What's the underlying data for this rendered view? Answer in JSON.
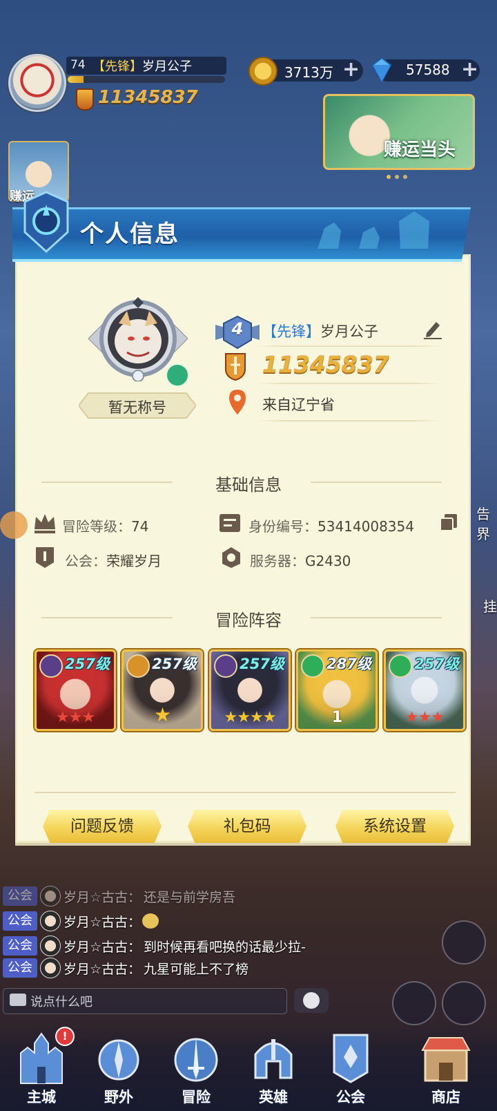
{
  "hud": {
    "level": "74",
    "guild_tag": "【先锋】",
    "player_name": "岁月公子",
    "xp_fraction": 0.1,
    "power": "11345837",
    "gold": "3713万",
    "gems": "57588",
    "plus": "+",
    "event_banner": "赚运当头",
    "side_event": "赚运"
  },
  "panel": {
    "title": "个人信息",
    "title_plate": "暂无称号",
    "rank": "4",
    "guild_tag": "【先锋】",
    "player_name": "岁月公子",
    "power": "11345837",
    "location": "来自辽宁省",
    "basic_section": "基础信息",
    "info": {
      "adventure_level_label": "冒险等级：",
      "adventure_level": "74",
      "id_label": "身份编号：",
      "id_value": "53414008354",
      "guild_label": "公会：",
      "guild_value": "荣耀岁月",
      "server_label": "服务器：",
      "server_value": "G2430"
    },
    "lineup_section": "冒险阵容",
    "heroes": [
      {
        "level": "257级",
        "stars": "★★★",
        "star_color": "#e84a3a"
      },
      {
        "level": "257级",
        "stars": "★",
        "star_color": "#f7c62a"
      },
      {
        "level": "257级",
        "stars": "★★★★",
        "star_color": "#f7c62a"
      },
      {
        "level": "287级",
        "stars": "1",
        "star_color": "#f7c62a"
      },
      {
        "level": "257级",
        "stars": "★★★",
        "star_color": "#e84a3a"
      }
    ],
    "buttons": {
      "feedback": "问题反馈",
      "gift_code": "礼包码",
      "settings": "系统设置"
    }
  },
  "chat": {
    "tag": "公会",
    "messages": [
      {
        "sender": "岁月☆古古：",
        "text": "还是与前学房吾"
      },
      {
        "sender": "岁月☆古古：",
        "text": ""
      },
      {
        "sender": "岁月☆古古：",
        "text": "到时候再看吧换的话最少拉-"
      },
      {
        "sender": "岁月☆古古：",
        "text": "九星可能上不了榜"
      }
    ],
    "placeholder": "说点什么吧"
  },
  "nav": {
    "items": [
      "主城",
      "野外",
      "冒险",
      "英雄",
      "公会",
      "商店"
    ],
    "badge": "!"
  },
  "side_labels": {
    "right_a": "告界",
    "right_b": "挂"
  }
}
